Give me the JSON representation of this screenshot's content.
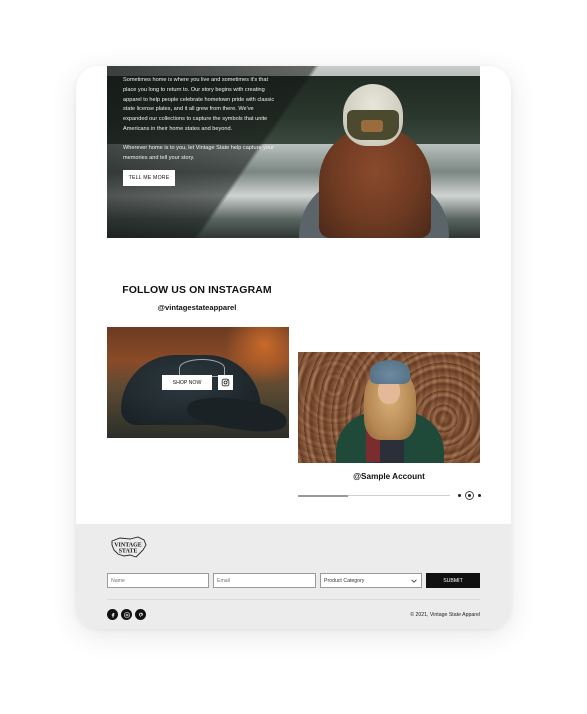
{
  "hero": {
    "paragraph1": "Sometimes home is where you live and sometimes it's that place you long to return to. Our story begins with creating apparel to help people celebrate hometown pride with classic state license plates, and it all grew from there. We've expanded our collections to capture the symbols that unite Americans in their home states and beyond.",
    "paragraph2": "Wherever home is to you, let Vintage State help capture your memories and tell your story.",
    "button_label": "TELL ME MORE"
  },
  "instagram": {
    "title": "FOLLOW US ON INSTAGRAM",
    "handle": "@vintagestateapparel",
    "shop_label": "SHOP NOW",
    "sample_account": "@Sample Account",
    "slider_progress": 0.33,
    "active_dot": 1
  },
  "footer": {
    "logo_line1": "VINTAGE",
    "logo_line2": "STATE",
    "form": {
      "name_placeholder": "Name",
      "email_placeholder": "Email",
      "category_value": "Product Category",
      "submit_label": "SUBMIT"
    },
    "social_icons": [
      "facebook-icon",
      "instagram-icon",
      "pinterest-icon"
    ],
    "copyright": "© 2021, Vintage State Apparel"
  },
  "colors": {
    "accent_dark": "#111111",
    "footer_bg": "#ececec"
  }
}
